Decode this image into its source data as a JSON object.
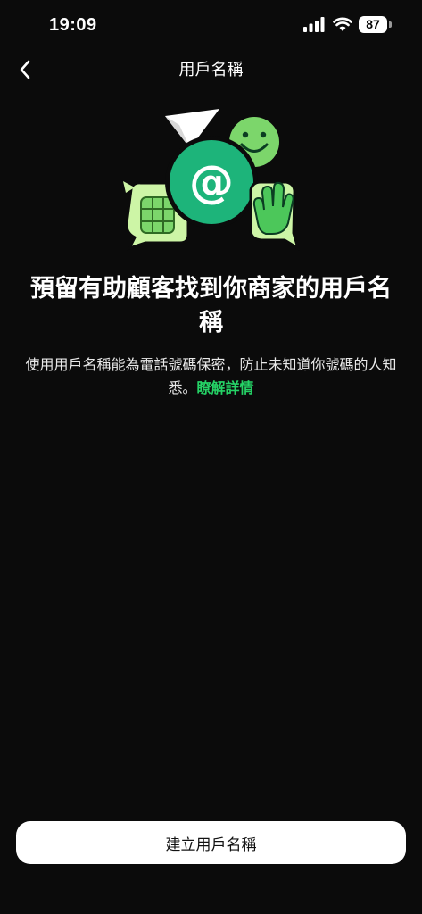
{
  "status_bar": {
    "time": "19:09",
    "battery_level": "87",
    "icons": [
      "signal-icon",
      "wifi-icon",
      "battery-icon"
    ]
  },
  "nav": {
    "title": "用戶名稱",
    "back_icon": "chevron-left-icon"
  },
  "hero": {
    "headline": "預留有助顧客找到你商家的用戶名稱",
    "description": "使用用戶名稱能為電話號碼保密，防止未知道你號碼的人知悉。",
    "learn_more": "瞭解詳情",
    "illustration_icons": [
      "paper-plane-icon",
      "smiley-icon",
      "at-sign-icon",
      "sim-card-chat-icon",
      "waving-hand-chat-icon"
    ]
  },
  "footer": {
    "create_button": "建立用戶名稱"
  },
  "colors": {
    "background": "#0b0b0b",
    "accent": "#25d366",
    "primary_green": "#1db47a",
    "light_green": "#7cd66b",
    "pale_green": "#cdf5a6",
    "button_bg": "#ffffff"
  }
}
